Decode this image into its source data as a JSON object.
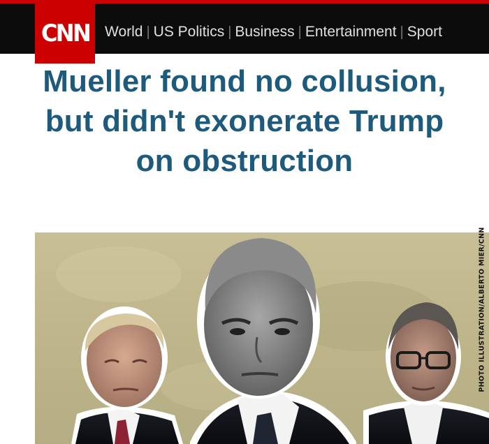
{
  "brand": {
    "logo_text": "CNN",
    "colors": {
      "brand_red": "#cc0000",
      "nav_background": "#0c0c0c",
      "headline": "#1d5a7c"
    }
  },
  "nav": {
    "items": [
      {
        "label": "World"
      },
      {
        "label": "US Politics"
      },
      {
        "label": "Business"
      },
      {
        "label": "Entertainment"
      },
      {
        "label": "Sport"
      }
    ]
  },
  "article": {
    "headline": "Mueller found no collusion, but didn't exonerate Trump on obstruction",
    "image": {
      "credit": "PHOTO ILLUSTRATION/ALBERTO MIER/CNN",
      "subjects": [
        "trump-portrait",
        "mueller-portrait",
        "barr-portrait"
      ]
    }
  }
}
